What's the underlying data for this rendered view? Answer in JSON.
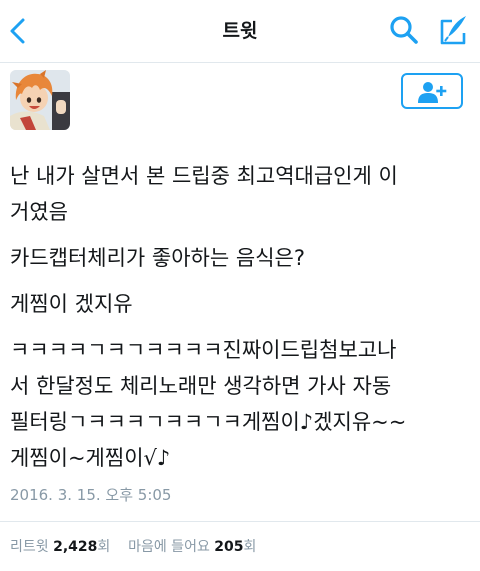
{
  "navbar": {
    "title": "트윗",
    "back_icon": "chevron-left-icon",
    "search_icon": "search-icon",
    "compose_icon": "compose-icon",
    "accent_color": "#1da1f2"
  },
  "tweet": {
    "avatar_icon": "avatar",
    "follow_icon": "add-user-icon",
    "lines": [
      "난 내가 살면서 본 드립중 최고역대급인게 이",
      "거였음",
      "카드캡터체리가 좋아하는 음식은?",
      "게찜이 겠지유",
      "ㅋㅋㅋㅋㄱㅋㄱㅋㅋㅋㅋ진짜이드립첨보고나",
      "서 한달정도 체리노래만 생각하면 가사 자동",
      "필터링ㄱㅋㅋㅋㄱㅋㅋㄱㅋ게찜이♪겠지유~~",
      "게찜이~게찜이√♪"
    ],
    "timestamp": "2016. 3. 15. 오후 5:05"
  },
  "stats": {
    "retweet_label": "리트윗",
    "retweet_count": "2,428",
    "retweet_unit": "회",
    "like_label": "마음에 들어요",
    "like_count": "205",
    "like_unit": "회"
  }
}
